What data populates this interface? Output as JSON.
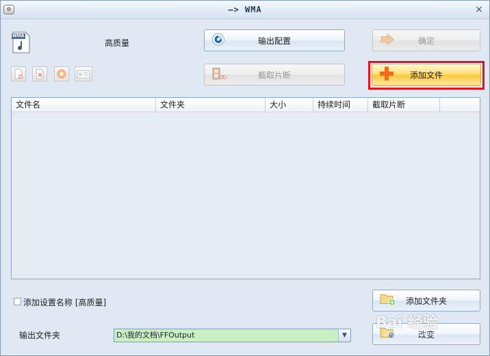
{
  "titlebar": {
    "title": "—> WMA",
    "close_glyph": "×"
  },
  "format_icon": {
    "label": "WMA"
  },
  "quality_label": "高质量",
  "buttons": {
    "output_config": "输出配置",
    "ok": "确定",
    "clip": "截取片断",
    "add_file": "添加文件",
    "add_folder": "添加文件夹",
    "change": "改变"
  },
  "file_table": {
    "columns": [
      "文件名",
      "文件夹",
      "大小",
      "持续时间",
      "截取片断"
    ],
    "rows": []
  },
  "add_setting_name_label": "添加设置名称 [高质量]",
  "output_folder": {
    "label": "输出文件夹",
    "path": "D:\\我的文档\\FFOutput"
  },
  "watermark": {
    "text": "Bai 经验",
    "sub": "jingyan.baidu.com"
  },
  "colors": {
    "highlight": "#e3141a",
    "path_bg": "#c9efc4",
    "add_file_bg": "#fbc73d"
  }
}
